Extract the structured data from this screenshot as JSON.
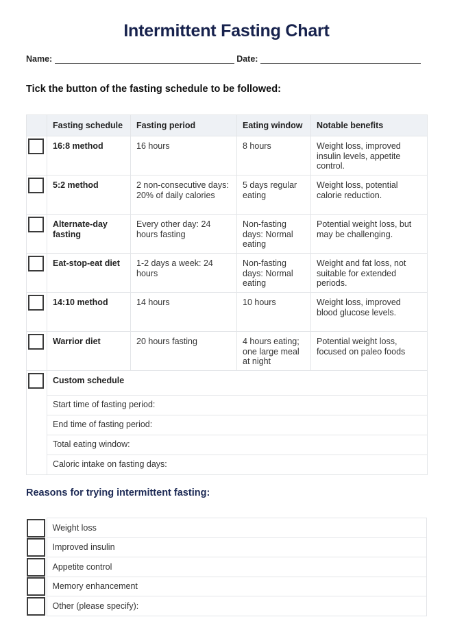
{
  "title": "Intermittent Fasting Chart",
  "form": {
    "name_label": "Name:",
    "date_label": "Date:"
  },
  "instruction": "Tick the button of the fasting schedule to be followed:",
  "schedule_table": {
    "headers": [
      "Fasting schedule",
      "Fasting period",
      "Eating window",
      "Notable benefits"
    ],
    "rows": [
      {
        "schedule": "16:8 method",
        "period": "16 hours",
        "window": "8 hours",
        "benefits": "Weight loss, improved insulin levels, appetite control.",
        "checked": false
      },
      {
        "schedule": "5:2 method",
        "period": "2 non-consecutive days: 20% of daily calories",
        "window": "5 days regular eating",
        "benefits": "Weight loss, potential calorie reduction.",
        "checked": false
      },
      {
        "schedule": "Alternate-day fasting",
        "period": "Every other day: 24 hours fasting",
        "window": "Non-fasting days: Normal eating",
        "benefits": "Potential weight loss, but may be challenging.",
        "checked": false
      },
      {
        "schedule": "Eat-stop-eat diet",
        "period": "1-2 days a week: 24 hours",
        "window": "Non-fasting days: Normal eating",
        "benefits": "Weight and fat loss, not suitable for extended periods.",
        "checked": false
      },
      {
        "schedule": "14:10 method",
        "period": "14 hours",
        "window": "10 hours",
        "benefits": "Weight loss, improved blood glucose levels.",
        "checked": false
      },
      {
        "schedule": "Warrior diet",
        "period": "20 hours fasting",
        "window": "4 hours eating; one large meal at night",
        "benefits": "Potential weight loss, focused on paleo foods",
        "checked": false
      }
    ],
    "custom": {
      "label": "Custom schedule",
      "checked": false,
      "fields": [
        "Start time of fasting period:",
        "End time of fasting period:",
        "Total eating window:",
        "Caloric intake on fasting days:"
      ]
    }
  },
  "reasons": {
    "title": "Reasons for trying intermittent fasting:",
    "items": [
      {
        "label": "Weight loss",
        "checked": false
      },
      {
        "label": "Improved insulin",
        "checked": false
      },
      {
        "label": "Appetite control",
        "checked": false
      },
      {
        "label": "Memory enhancement",
        "checked": false
      },
      {
        "label": "Other (please specify):",
        "checked": false
      }
    ]
  },
  "colors": {
    "title": "#17224d",
    "section_title": "#1d2a55",
    "header_bg": "#eef1f5",
    "border": "#e3e5e8"
  }
}
